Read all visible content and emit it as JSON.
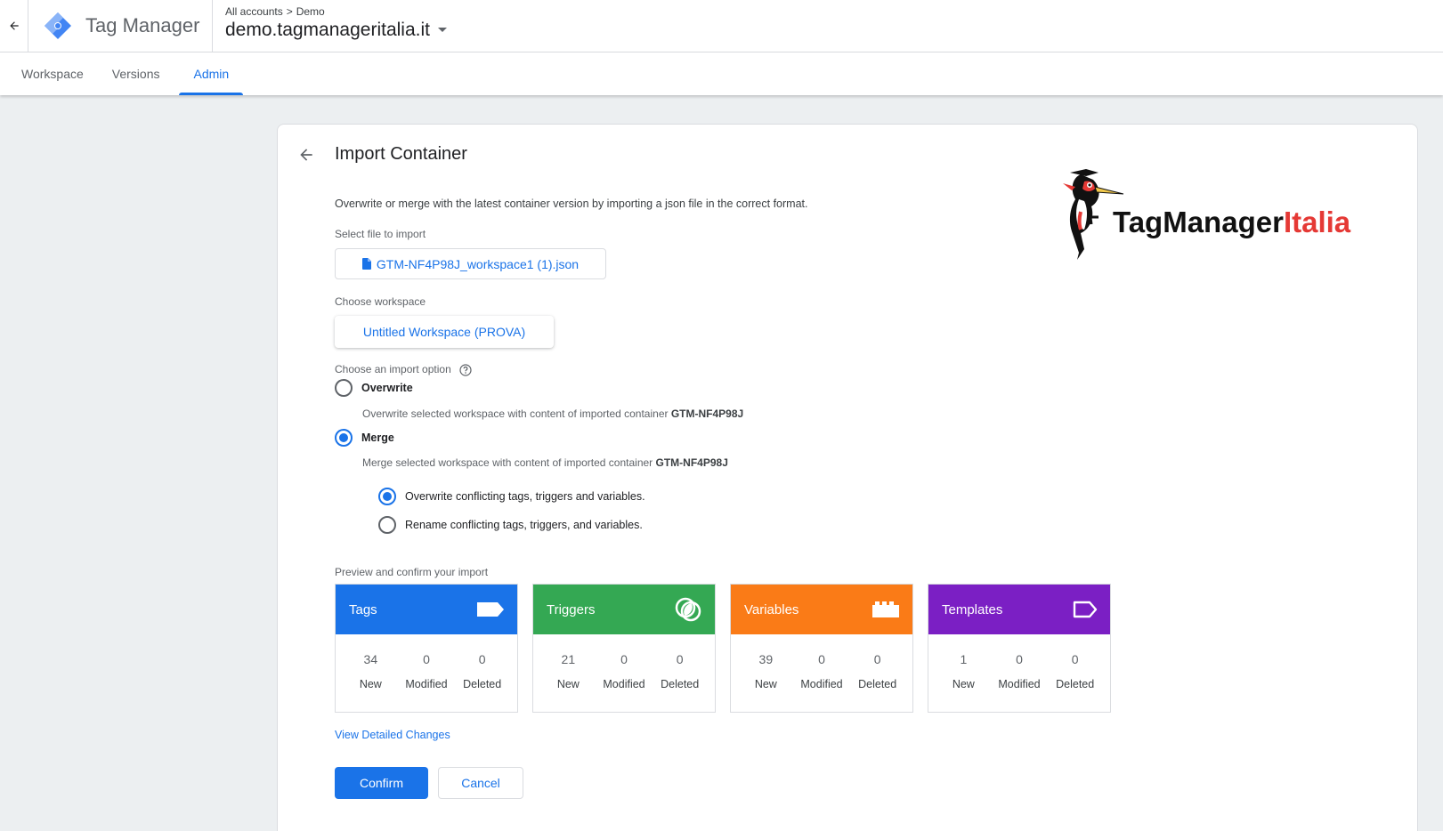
{
  "header": {
    "app_title": "Tag Manager",
    "breadcrumb": {
      "account": "All accounts",
      "separator": ">",
      "current": "Demo"
    },
    "container_name": "demo.tagmanageritalia.it"
  },
  "tabs": [
    {
      "label": "Workspace"
    },
    {
      "label": "Versions"
    },
    {
      "label": "Admin",
      "active": true
    }
  ],
  "import_panel": {
    "title": "Import Container",
    "description": "Overwrite or merge with the latest container version by importing a json file in the correct format.",
    "file_label": "Select file to import",
    "file_name": "GTM-NF4P98J_workspace1 (1).json",
    "workspace_label": "Choose workspace",
    "workspace_name": "Untitled Workspace (PROVA)",
    "option_label": "Choose an import option",
    "options": {
      "overwrite": {
        "label": "Overwrite",
        "desc": "Overwrite selected workspace with content of imported container ",
        "container_id": "GTM-NF4P98J",
        "selected": false
      },
      "merge": {
        "label": "Merge",
        "desc": "Merge selected workspace with content of imported container ",
        "container_id": "GTM-NF4P98J",
        "selected": true
      }
    },
    "merge_options": {
      "overwrite_conflicts": {
        "label": "Overwrite conflicting tags, triggers and variables.",
        "selected": true
      },
      "rename_conflicts": {
        "label": "Rename conflicting tags, triggers, and variables.",
        "selected": false
      }
    },
    "preview_label": "Preview and confirm your import",
    "cards": {
      "tags": {
        "title": "Tags",
        "icon": "tag-icon",
        "color": "#1a73e8",
        "new": "34",
        "modified": "0",
        "deleted": "0"
      },
      "triggers": {
        "title": "Triggers",
        "icon": "trigger-icon",
        "color": "#34a853",
        "new": "21",
        "modified": "0",
        "deleted": "0"
      },
      "variables": {
        "title": "Variables",
        "icon": "variable-icon",
        "color": "#fa7b17",
        "new": "39",
        "modified": "0",
        "deleted": "0"
      },
      "templates": {
        "title": "Templates",
        "icon": "template-icon",
        "color": "#7b1fc4",
        "new": "1",
        "modified": "0",
        "deleted": "0"
      }
    },
    "stat_labels": {
      "new": "New",
      "modified": "Modified",
      "deleted": "Deleted"
    },
    "detail_link": "View Detailed Changes",
    "confirm_label": "Confirm",
    "cancel_label": "Cancel"
  },
  "watermark": {
    "text_main": "TagManager",
    "text_accent": "Italia",
    "accent_color": "#e53935"
  }
}
